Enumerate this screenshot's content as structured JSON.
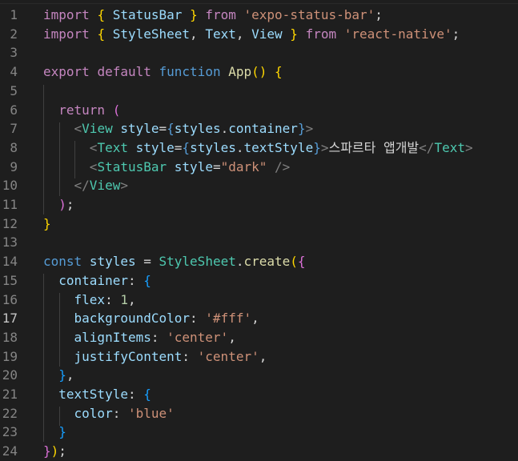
{
  "editor": {
    "active_line": 17,
    "line_numbers": [
      "1",
      "2",
      "3",
      "4",
      "5",
      "6",
      "7",
      "8",
      "9",
      "10",
      "11",
      "12",
      "13",
      "14",
      "15",
      "16",
      "17",
      "18",
      "19",
      "20",
      "21",
      "22",
      "23",
      "24"
    ],
    "lines": [
      [
        [
          "kw",
          "import"
        ],
        [
          "punc",
          " "
        ],
        [
          "b1",
          "{"
        ],
        [
          "punc",
          " "
        ],
        [
          "var",
          "StatusBar"
        ],
        [
          "punc",
          " "
        ],
        [
          "b1",
          "}"
        ],
        [
          "punc",
          " "
        ],
        [
          "kw",
          "from"
        ],
        [
          "punc",
          " "
        ],
        [
          "str",
          "'expo-status-bar'"
        ],
        [
          "punc",
          ";"
        ]
      ],
      [
        [
          "kw",
          "import"
        ],
        [
          "punc",
          " "
        ],
        [
          "b1",
          "{"
        ],
        [
          "punc",
          " "
        ],
        [
          "var",
          "StyleSheet"
        ],
        [
          "punc",
          ", "
        ],
        [
          "var",
          "Text"
        ],
        [
          "punc",
          ", "
        ],
        [
          "var",
          "View"
        ],
        [
          "punc",
          " "
        ],
        [
          "b1",
          "}"
        ],
        [
          "punc",
          " "
        ],
        [
          "kw",
          "from"
        ],
        [
          "punc",
          " "
        ],
        [
          "str",
          "'react-native'"
        ],
        [
          "punc",
          ";"
        ]
      ],
      [],
      [
        [
          "kw",
          "export"
        ],
        [
          "punc",
          " "
        ],
        [
          "kw",
          "default"
        ],
        [
          "punc",
          " "
        ],
        [
          "st",
          "function"
        ],
        [
          "punc",
          " "
        ],
        [
          "fn",
          "App"
        ],
        [
          "b1",
          "()"
        ],
        [
          "punc",
          " "
        ],
        [
          "b1",
          "{"
        ]
      ],
      [],
      [
        [
          "punc",
          "  "
        ],
        [
          "kw",
          "return"
        ],
        [
          "punc",
          " "
        ],
        [
          "b2",
          "("
        ]
      ],
      [
        [
          "punc",
          "    "
        ],
        [
          "tag",
          "<"
        ],
        [
          "cls",
          "View"
        ],
        [
          "punc",
          " "
        ],
        [
          "var",
          "style"
        ],
        [
          "punc",
          "="
        ],
        [
          "st",
          "{"
        ],
        [
          "var",
          "styles"
        ],
        [
          "punc",
          "."
        ],
        [
          "var",
          "container"
        ],
        [
          "st",
          "}"
        ],
        [
          "tag",
          ">"
        ]
      ],
      [
        [
          "punc",
          "      "
        ],
        [
          "tag",
          "<"
        ],
        [
          "cls",
          "Text"
        ],
        [
          "punc",
          " "
        ],
        [
          "var",
          "style"
        ],
        [
          "punc",
          "="
        ],
        [
          "st",
          "{"
        ],
        [
          "var",
          "styles"
        ],
        [
          "punc",
          "."
        ],
        [
          "var",
          "textStyle"
        ],
        [
          "st",
          "}"
        ],
        [
          "tag",
          ">"
        ],
        [
          "punc",
          "스파르타 앱개발"
        ],
        [
          "tag",
          "</"
        ],
        [
          "cls",
          "Text"
        ],
        [
          "tag",
          ">"
        ]
      ],
      [
        [
          "punc",
          "      "
        ],
        [
          "tag",
          "<"
        ],
        [
          "cls",
          "StatusBar"
        ],
        [
          "punc",
          " "
        ],
        [
          "var",
          "style"
        ],
        [
          "punc",
          "="
        ],
        [
          "str",
          "\"dark\""
        ],
        [
          "punc",
          " "
        ],
        [
          "tag",
          "/>"
        ]
      ],
      [
        [
          "punc",
          "    "
        ],
        [
          "tag",
          "</"
        ],
        [
          "cls",
          "View"
        ],
        [
          "tag",
          ">"
        ]
      ],
      [
        [
          "punc",
          "  "
        ],
        [
          "b2",
          ")"
        ],
        [
          "punc",
          ";"
        ]
      ],
      [
        [
          "b1",
          "}"
        ]
      ],
      [],
      [
        [
          "st",
          "const"
        ],
        [
          "punc",
          " "
        ],
        [
          "var",
          "styles"
        ],
        [
          "punc",
          " = "
        ],
        [
          "cls",
          "StyleSheet"
        ],
        [
          "punc",
          "."
        ],
        [
          "fn",
          "create"
        ],
        [
          "b1",
          "("
        ],
        [
          "b2",
          "{"
        ]
      ],
      [
        [
          "punc",
          "  "
        ],
        [
          "var",
          "container"
        ],
        [
          "punc",
          ": "
        ],
        [
          "b3",
          "{"
        ]
      ],
      [
        [
          "punc",
          "    "
        ],
        [
          "var",
          "flex"
        ],
        [
          "punc",
          ": "
        ],
        [
          "num",
          "1"
        ],
        [
          "punc",
          ","
        ]
      ],
      [
        [
          "punc",
          "    "
        ],
        [
          "var",
          "backgroundColor"
        ],
        [
          "punc",
          ": "
        ],
        [
          "str",
          "'#fff'"
        ],
        [
          "punc",
          ","
        ]
      ],
      [
        [
          "punc",
          "    "
        ],
        [
          "var",
          "alignItems"
        ],
        [
          "punc",
          ": "
        ],
        [
          "str",
          "'center'"
        ],
        [
          "punc",
          ","
        ]
      ],
      [
        [
          "punc",
          "    "
        ],
        [
          "var",
          "justifyContent"
        ],
        [
          "punc",
          ": "
        ],
        [
          "str",
          "'center'"
        ],
        [
          "punc",
          ","
        ]
      ],
      [
        [
          "punc",
          "  "
        ],
        [
          "b3",
          "}"
        ],
        [
          "punc",
          ","
        ]
      ],
      [
        [
          "punc",
          "  "
        ],
        [
          "var",
          "textStyle"
        ],
        [
          "punc",
          ": "
        ],
        [
          "b3",
          "{"
        ]
      ],
      [
        [
          "punc",
          "    "
        ],
        [
          "var",
          "color"
        ],
        [
          "punc",
          ": "
        ],
        [
          "str",
          "'blue'"
        ]
      ],
      [
        [
          "punc",
          "  "
        ],
        [
          "b3",
          "}"
        ]
      ],
      [
        [
          "b2",
          "}"
        ],
        [
          "b1",
          ")"
        ],
        [
          "punc",
          ";"
        ]
      ]
    ]
  }
}
